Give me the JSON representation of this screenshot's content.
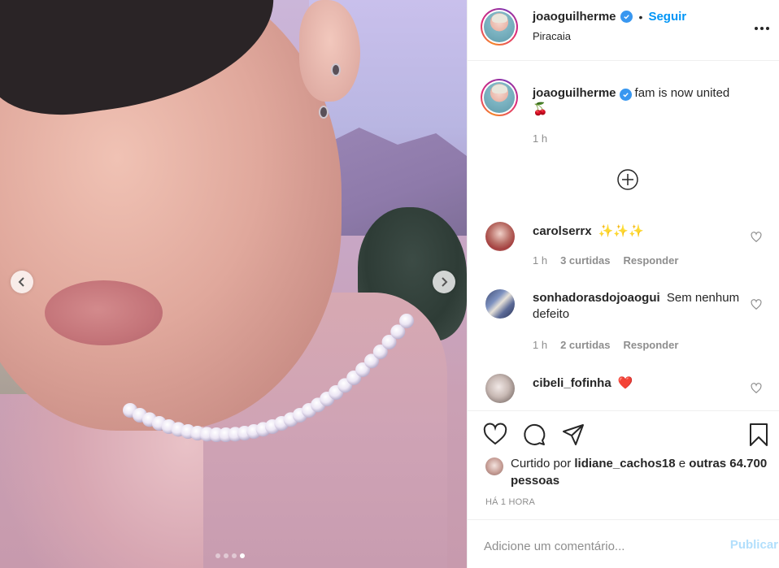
{
  "post": {
    "author": "joaoguilherme",
    "follow_label": "Seguir",
    "separator": "•",
    "location": "Piracaia"
  },
  "caption": {
    "author": "joaoguilherme",
    "text": "fam is now united",
    "emoji": "🍒",
    "time": "1 h"
  },
  "comments": [
    {
      "user": "carolserrx",
      "text": "✨✨✨",
      "time": "1 h",
      "likes": "3 curtidas",
      "reply": "Responder"
    },
    {
      "user": "sonhadorasdojoaogui",
      "text": "Sem nenhum defeito",
      "time": "1 h",
      "likes": "2 curtidas",
      "reply": "Responder"
    },
    {
      "user": "cibeli_fofinha",
      "text": "❤️"
    }
  ],
  "likes": {
    "prefix": "Curtido por",
    "user": "lidiane_cachos18",
    "connector": "e",
    "others": "outras 64.700 pessoas"
  },
  "post_age": "HÁ 1 HORA",
  "add_comment": {
    "placeholder": "Adicione um comentário...",
    "publish_label": "Publicar"
  },
  "carousel": {
    "slides": 4,
    "active": 4
  },
  "colors": {
    "accent": "#0095f6",
    "verified": "#3897f0",
    "publish_disabled": "#b2dffc",
    "muted": "#8e8e8e"
  },
  "icons": [
    "chevron-left-icon",
    "chevron-right-icon",
    "more-icon",
    "verified-icon",
    "plus-circle-icon",
    "heart-icon",
    "comment-icon",
    "share-icon",
    "bookmark-icon"
  ]
}
